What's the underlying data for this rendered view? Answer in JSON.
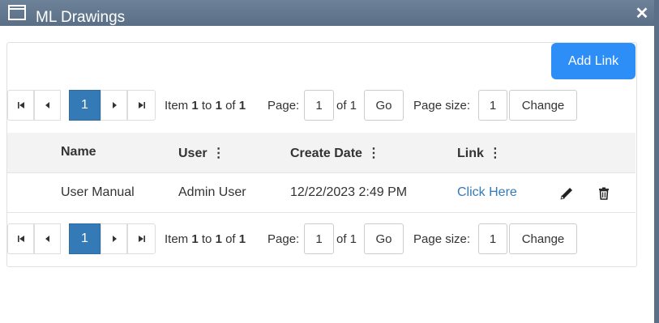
{
  "window": {
    "title": "ML Drawings",
    "close_glyph": "✕",
    "title_icon": "window-icon"
  },
  "toolbar": {
    "add_link_label": "Add Link"
  },
  "pager": {
    "first_icon": "first-page-icon",
    "prev_icon": "prev-page-icon",
    "next_icon": "next-page-icon",
    "last_icon": "last-page-icon",
    "current_page": "1",
    "item_prefix": "Item",
    "item_from": "1",
    "item_to_word": "to",
    "item_to": "1",
    "item_of_word": "of",
    "item_total": "1",
    "page_label": "Page:",
    "page_value": "1",
    "of_pages": "of 1",
    "go_label": "Go",
    "page_size_label": "Page size:",
    "page_size_value": "1",
    "change_label": "Change"
  },
  "table": {
    "columns": [
      "Name",
      "User",
      "Create Date",
      "Link"
    ],
    "kebab_glyph": "⋮",
    "rows": [
      {
        "name": "User Manual",
        "user": "Admin User",
        "create_date": "12/22/2023 2:49 PM",
        "link": "Click Here",
        "edit_icon": "edit-icon",
        "delete_icon": "trash-icon"
      }
    ]
  },
  "colors": {
    "accent": "#2e8ef7",
    "pager_active": "#337ab7",
    "titlebar": "#5a6f86",
    "link": "#337ab7"
  }
}
